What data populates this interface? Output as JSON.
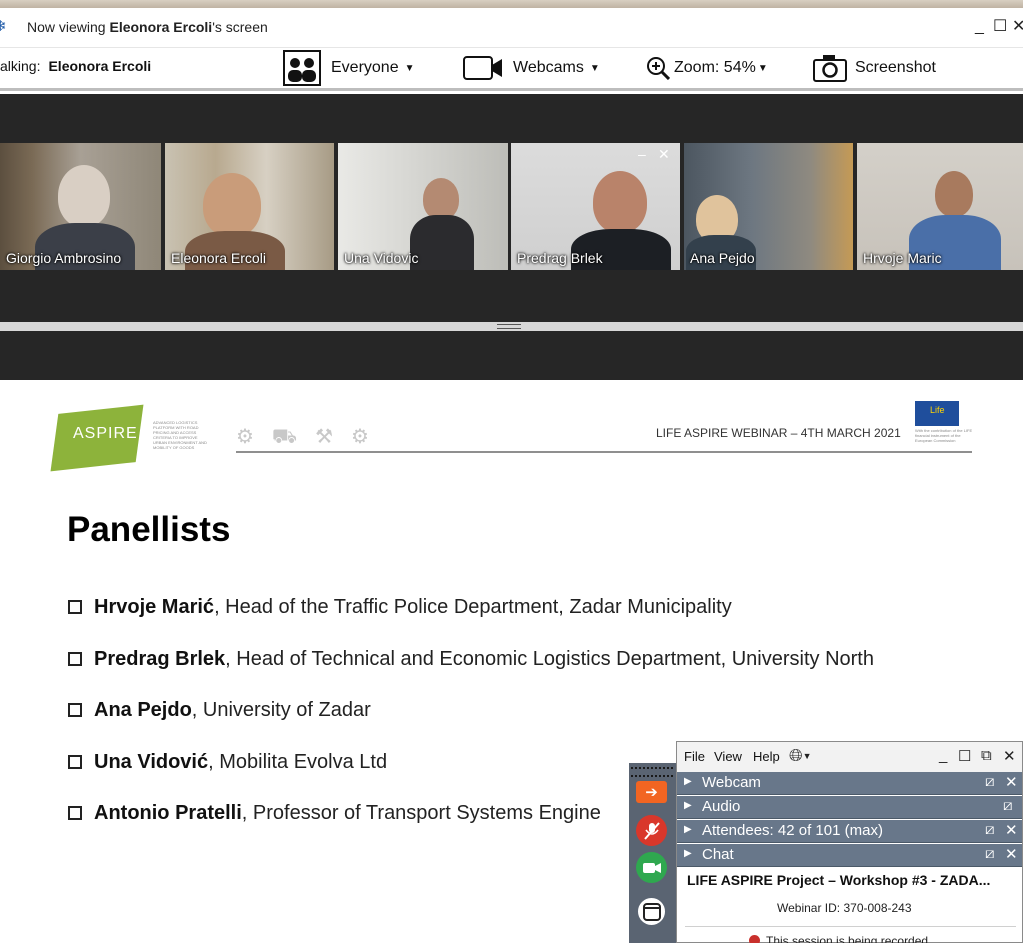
{
  "window": {
    "viewing_prefix": "Now viewing ",
    "viewing_name": "Eleonora Ercoli",
    "viewing_suffix": "'s screen",
    "controls": {
      "minimize": "_",
      "maximize": "☐",
      "close": "✕"
    }
  },
  "toolbar": {
    "talking_label": "alking:",
    "talking_name": "Eleonora Ercoli",
    "everyone_label": "Everyone",
    "webcams_label": "Webcams",
    "zoom_label": "Zoom: 54%",
    "screenshot_label": "Screenshot",
    "caret": "▼"
  },
  "webcams": [
    {
      "name": "Giorgio Ambrosino"
    },
    {
      "name": "Eleonora Ercoli",
      "active": true
    },
    {
      "name": "Una Vidovic"
    },
    {
      "name": "Predrag Brlek",
      "controls": [
        "–",
        "✕"
      ]
    },
    {
      "name": "Ana Pejdo"
    },
    {
      "name": "Hrvoje Maric"
    }
  ],
  "slide": {
    "logo_text": "ASPIRE",
    "logo_tagline": "ADVANCED LOGISTICS PLATFORM WITH ROAD PRICING AND ACCESS CRITERIA TO IMPROVE URBAN ENVIRONMENT AND MOBILITY OF GOODS",
    "header": "LIFE ASPIRE WEBINAR – 4TH MARCH 2021",
    "eu_note": "With the contribution of the LIFE financial instrument of the European Commission",
    "eu_flag_mark": "Life",
    "title": "Panellists",
    "panellists": [
      {
        "name": "Hrvoje Marić",
        "role": ", Head of the Traffic Police Department, Zadar Municipality"
      },
      {
        "name": "Predrag Brlek",
        "role": ", Head of Technical and Economic Logistics Department, University North"
      },
      {
        "name": "Ana Pejdo",
        "role": ", University of Zadar"
      },
      {
        "name": "Una Vidović",
        "role": ", Mobilita Evolva Ltd"
      },
      {
        "name": "Antonio Pratelli",
        "role": ", Professor of Transport Systems Engine"
      }
    ]
  },
  "gtw_panel": {
    "menu": {
      "file": "File",
      "view": "View",
      "help": "Help"
    },
    "sections": [
      {
        "label": "Webcam"
      },
      {
        "label": "Audio"
      },
      {
        "label": "Attendees:  42 of 101 (max)"
      },
      {
        "label": "Chat"
      }
    ],
    "webinar_title": "LIFE ASPIRE Project – Workshop #3  - ZADA...",
    "webinar_id": "Webinar ID: 370-008-243",
    "recording": "This session is being recorded"
  },
  "colors": {
    "active_tile_border": "#38a169",
    "logo_green": "#8db33b",
    "panel_section": "#68778a",
    "record_red": "#c9302c"
  }
}
